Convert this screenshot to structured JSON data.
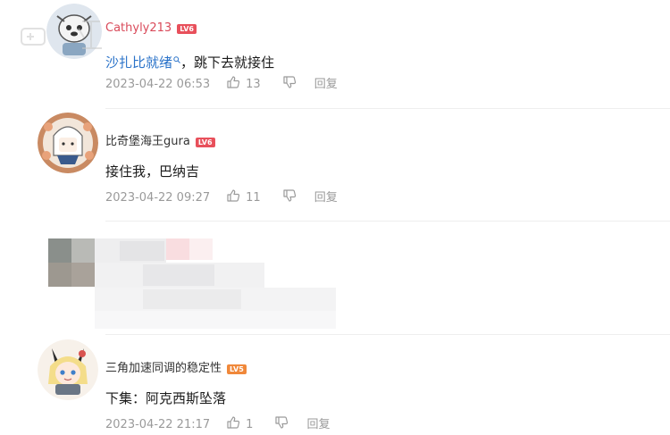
{
  "comments": [
    {
      "username": "Cathyly213",
      "username_color": "#d94a5a",
      "level": "LV6",
      "level_color": "#e8505b",
      "content_link": "沙扎比就绪",
      "content_text": "，跳下去就接住",
      "timestamp": "2023-04-22 06:53",
      "likes": "13",
      "reply_label": "回复"
    },
    {
      "username": "比奇堡海王gura",
      "username_color": "#333333",
      "level": "LV6",
      "level_color": "#e8505b",
      "content_text": "接住我，巴纳吉",
      "timestamp": "2023-04-22 09:27",
      "likes": "11",
      "reply_label": "回复"
    },
    {
      "username": "三角加速同调的稳定性",
      "username_color": "#333333",
      "level": "LV5",
      "level_color": "#f0883a",
      "content_text": "下集：阿克西斯坠落",
      "timestamp": "2023-04-22 21:17",
      "likes": "1",
      "reply_label": "回复"
    }
  ],
  "icons": {
    "like": "thumbs-up-icon",
    "dislike": "thumbs-down-icon",
    "search": "search-icon"
  },
  "colors": {
    "link": "#2b73c9",
    "meta": "#9a9a9a",
    "divider": "#eeeeee"
  }
}
